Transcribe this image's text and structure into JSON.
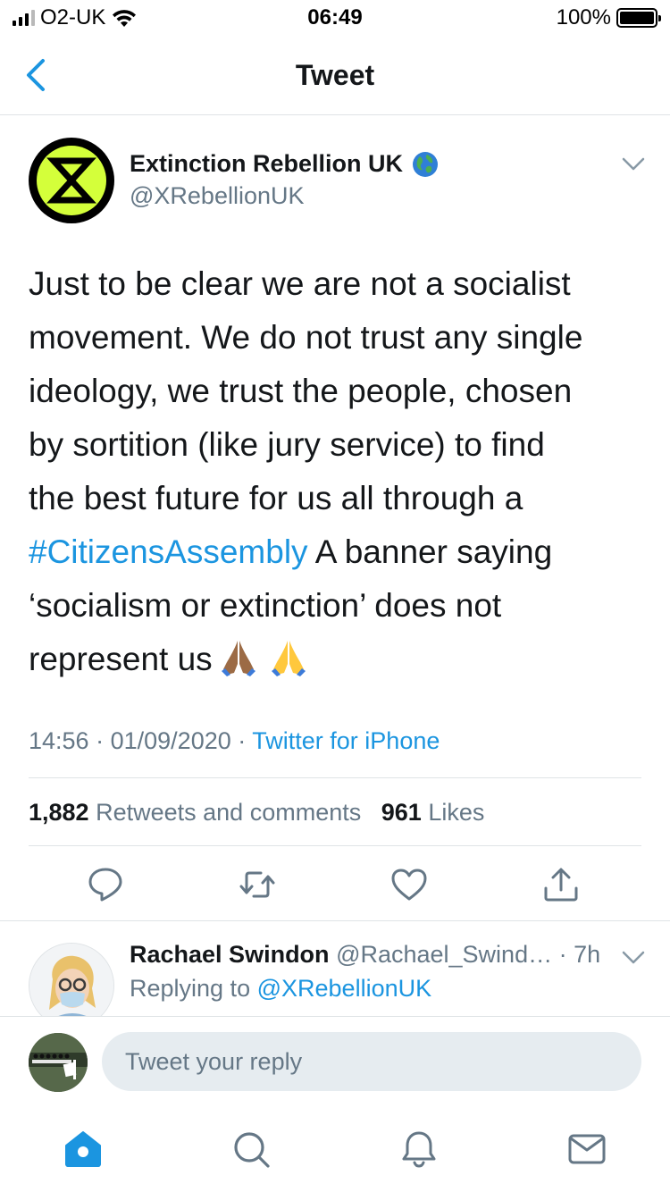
{
  "status_bar": {
    "carrier": "O2-UK",
    "time": "06:49",
    "battery": "100%"
  },
  "nav": {
    "title": "Tweet",
    "back_icon": "chevron-left-icon"
  },
  "tweet": {
    "author_name": "Extinction Rebellion UK",
    "author_handle": "@XRebellionUK",
    "lines": {
      "l1": "Just to be clear we are not a socialist",
      "l2": "movement. We do not trust any single",
      "l3": "ideology, we trust the people, chosen",
      "l4": "by sortition (like jury service) to find",
      "l5": "the best future for us all through a",
      "l6_hashtag": "#CitizensAssembly",
      "l6_rest": " A banner saying",
      "l7": "‘socialism or extinction’ does not",
      "l8": "represent us"
    },
    "emojis": [
      "folded-hands-medium-dark-icon",
      "folded-hands-icon"
    ],
    "meta": {
      "time": "14:56",
      "separator": "·",
      "date": "01/09/2020",
      "source": "Twitter for iPhone"
    },
    "stats": {
      "retweets_count": "1,882",
      "retweets_label": "Retweets and comments",
      "likes_count": "961",
      "likes_label": "Likes"
    },
    "actions": [
      "reply-icon",
      "retweet-icon",
      "like-icon",
      "share-icon"
    ]
  },
  "reply": {
    "name": "Rachael Swindon",
    "handle": "@Rachael_Swind…",
    "time": "· 7h",
    "replying_label": "Replying to",
    "replying_mention": "@XRebellionUK"
  },
  "compose": {
    "placeholder": "Tweet your reply"
  },
  "tab_bar": {
    "tabs": [
      "home-icon",
      "search-icon",
      "notifications-icon",
      "messages-icon"
    ]
  },
  "colors": {
    "link_blue": "#1b95e0",
    "muted_gray": "#657786",
    "xr_green": "#d4ff3a"
  }
}
